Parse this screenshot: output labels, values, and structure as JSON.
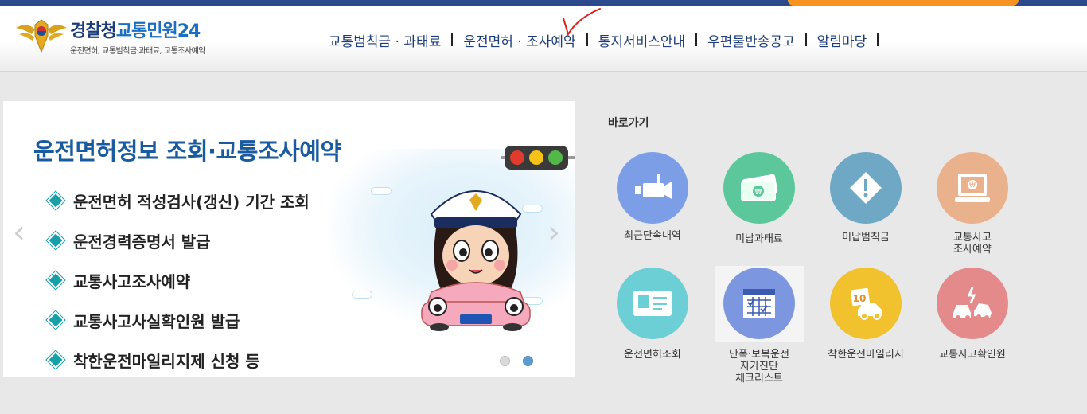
{
  "header": {
    "logo_brand": "경찰청",
    "logo_service": "교통민원24",
    "logo_tagline": "운전면허, 교통범칙금·과태료, 교통조사예약"
  },
  "nav": {
    "items": [
      "교통범칙금 · 과태료",
      "운전면허 · 조사예약",
      "통지서비스안내",
      "우편물반송공고",
      "알림마당"
    ]
  },
  "banner": {
    "title": "운전면허정보 조회·교통조사예약",
    "items": [
      "운전면허 적성검사(갱신) 기간 조회",
      "운전경력증명서 발급",
      "교통사고조사예약",
      "교통사고사실확인원 발급",
      "착한운전마일리지제 신청 등"
    ],
    "arrow_left": "‹",
    "arrow_right": "›",
    "slide_count": 2,
    "active_slide": 2
  },
  "shortcuts": {
    "title": "바로가기",
    "items": [
      {
        "label": "최근단속내역",
        "icon": "camera-icon",
        "color": "#7c9ee6"
      },
      {
        "label": "미납과태료",
        "icon": "money-icon",
        "color": "#5cc79a"
      },
      {
        "label": "미납범칙금",
        "icon": "warning-icon",
        "color": "#6fa8c4"
      },
      {
        "label": "교통사고\n조사예약",
        "icon": "monitor-icon",
        "color": "#eab18d"
      },
      {
        "label": "운전면허조회",
        "icon": "license-card-icon",
        "color": "#6ccfd6"
      },
      {
        "label": "난폭·보복운전\n자가진단\n체크리스트",
        "icon": "calendar-check-icon",
        "color": "#7d96e0"
      },
      {
        "label": "착한운전마일리지",
        "icon": "mileage-car-icon",
        "color": "#f2c12e"
      },
      {
        "label": "교통사고확인원",
        "icon": "car-crash-icon",
        "color": "#e58a8a"
      }
    ]
  }
}
